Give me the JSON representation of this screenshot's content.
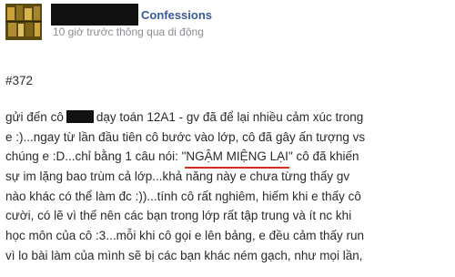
{
  "header": {
    "page_name": "Confessions",
    "meta": "10 giờ trước thông qua di động"
  },
  "post": {
    "number": "#372",
    "line1_a": "gửi đến cô",
    "line1_b": "dạy toán 12A1 - gv đã để lại nhiều cảm xúc trong",
    "line2": "e :)...ngay từ lần đầu tiên cô bước vào lớp, cô đã gây ấn tượng vs",
    "line3_a": "chúng e :D...chỉ bằng 1 câu nói: \"",
    "line3_highlight": "NGẬM MIỆNG LẠI",
    "line3_b": "\" cô đã khiến",
    "line4": "sự im lặng bao trùm cả lớp...khả năng này e chưa từng thấy gv",
    "line5": "nào khác có thể làm đc :))...tính cô rất nghiêm, hiếm khi e thấy cô",
    "line6": "cười, có lẽ vì thế nên các bạn trong lớp rất tập trung và ít nc khi",
    "line7": "học môn của cô :3...mỗi khi cô gọi e lên bảng, e đều cảm thấy run",
    "line8": "vì lo bài làm của mình sẽ bị các bạn khác ném gạch, như mọi lần,"
  },
  "colors": {
    "page_name": "#3b5998",
    "meta": "#8a8d91",
    "underline": "#d92a1e",
    "redaction": "#111111"
  }
}
